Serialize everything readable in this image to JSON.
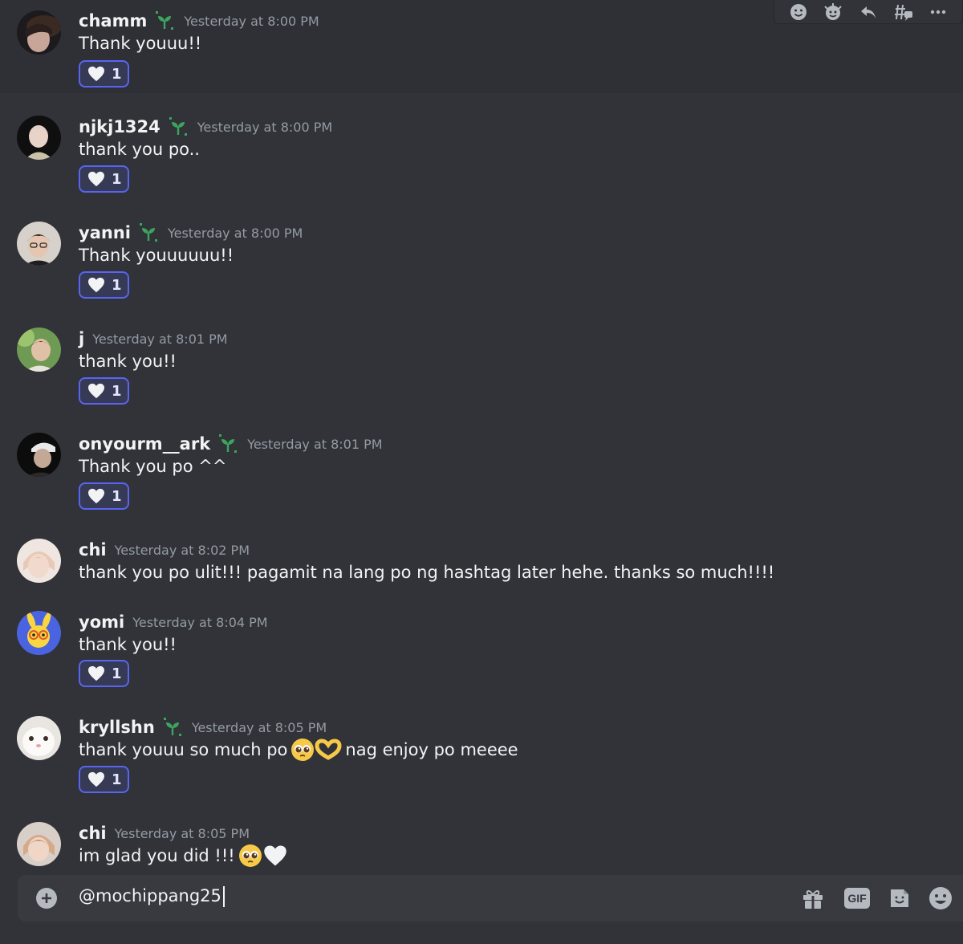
{
  "colors": {
    "background": "#313338",
    "accent": "#5865f2",
    "username": "#f2f3f5",
    "timestamp": "#949ba4",
    "badge": "#3ba55d"
  },
  "message_actions": [
    {
      "icon": "add-reaction-icon"
    },
    {
      "icon": "super-reaction-icon"
    },
    {
      "icon": "reply-icon"
    },
    {
      "icon": "create-thread-icon"
    },
    {
      "icon": "more-icon"
    }
  ],
  "messages": [
    {
      "username": "chamm",
      "badge": "sprout-badge-icon",
      "timestamp": "Yesterday at 8:00 PM",
      "text": "Thank youuu!!",
      "reaction": {
        "emoji": "white-heart-icon",
        "count": "1"
      }
    },
    {
      "username": "njkj1324",
      "badge": "sprout-badge-icon",
      "timestamp": "Yesterday at 8:00 PM",
      "text": "thank you po..",
      "reaction": {
        "emoji": "white-heart-icon",
        "count": "1"
      }
    },
    {
      "username": "yanni",
      "badge": "sprout-badge-icon",
      "timestamp": "Yesterday at 8:00 PM",
      "text": "Thank youuuuuu!!",
      "reaction": {
        "emoji": "white-heart-icon",
        "count": "1"
      }
    },
    {
      "username": "j",
      "timestamp": "Yesterday at 8:01 PM",
      "text": "thank you!!",
      "reaction": {
        "emoji": "white-heart-icon",
        "count": "1"
      }
    },
    {
      "username": "onyourm__ark",
      "badge": "sprout-badge-icon",
      "timestamp": "Yesterday at 8:01 PM",
      "text": "Thank you po ^^",
      "reaction": {
        "emoji": "white-heart-icon",
        "count": "1"
      }
    },
    {
      "username": "chi",
      "timestamp": "Yesterday at 8:02 PM",
      "text": "thank you po ulit!!! pagamit na lang po ng hashtag later hehe. thanks so much!!!!"
    },
    {
      "username": "yomi",
      "timestamp": "Yesterday at 8:04 PM",
      "text": "thank you!!",
      "reaction": {
        "emoji": "white-heart-icon",
        "count": "1"
      }
    },
    {
      "username": "kryllshn",
      "badge": "sprout-badge-icon",
      "timestamp": "Yesterday at 8:05 PM",
      "text": "thank youuu so much po",
      "text_emojis": [
        "pleading-face-emoji",
        "heart-hands-emoji"
      ],
      "text_after": "nag enjoy po meeee",
      "reaction": {
        "emoji": "white-heart-icon",
        "count": "1"
      }
    },
    {
      "username": "chi",
      "timestamp": "Yesterday at 8:05 PM",
      "text": "im glad you did !!!",
      "text_emojis": [
        "pleading-face-emoji",
        "white-heart-emoji"
      ]
    }
  ],
  "composer": {
    "value": "@mochippang25",
    "buttons": [
      {
        "icon": "gift-icon"
      },
      {
        "icon": "gif-icon",
        "label": "GIF"
      },
      {
        "icon": "sticker-icon"
      },
      {
        "icon": "emoji-icon"
      }
    ]
  }
}
